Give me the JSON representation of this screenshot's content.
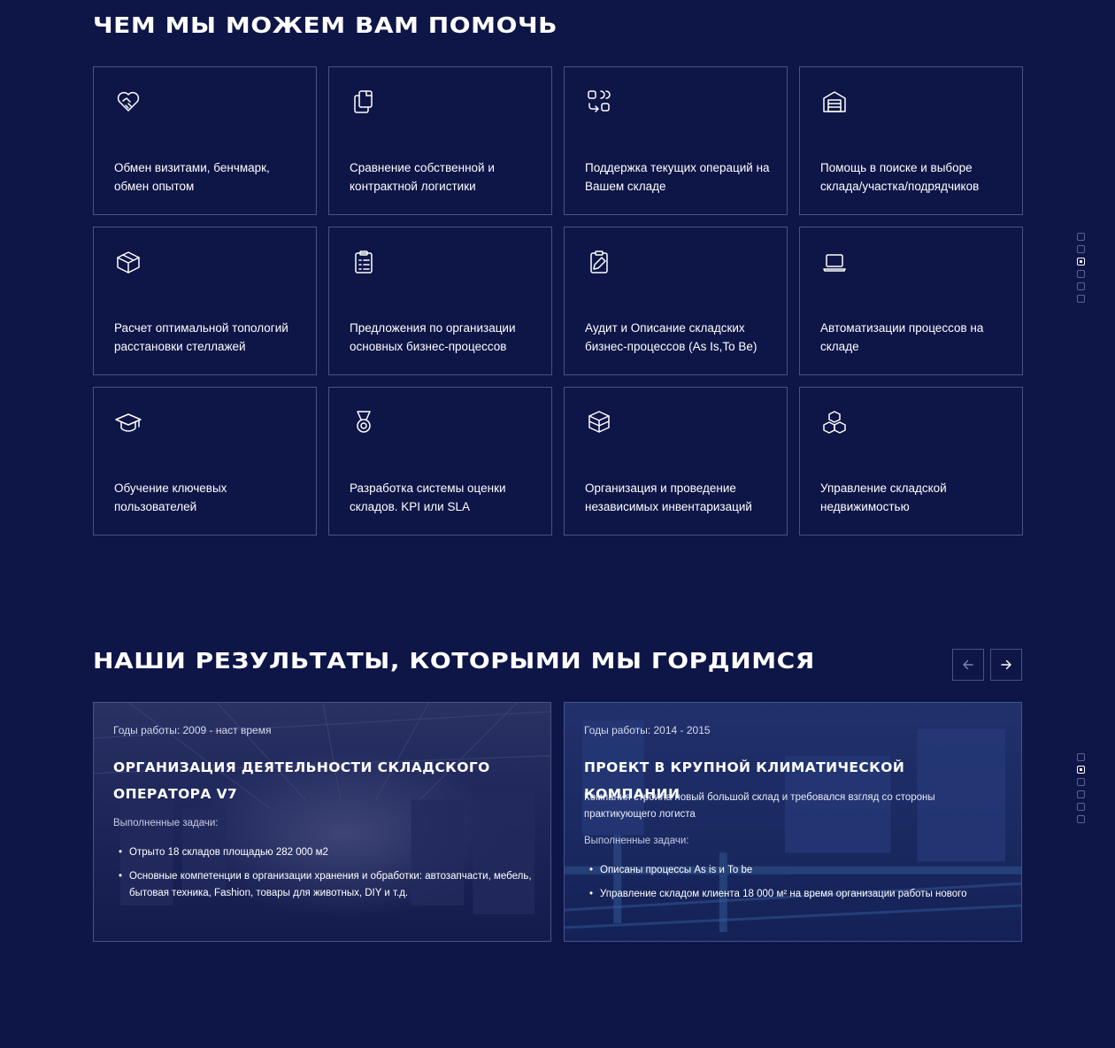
{
  "services": {
    "title": "ЧЕМ МЫ МОЖЕМ ВАМ ПОМОЧЬ",
    "cards": [
      {
        "icon": "handshake-heart-icon",
        "text": "Обмен визитами, бенчмарк, обмен опытом"
      },
      {
        "icon": "documents-copy-icon",
        "text": "Сравнение собственной и контрактной логистики"
      },
      {
        "icon": "workflow-shapes-icon",
        "text": "Поддержка текущих операций на Вашем складе"
      },
      {
        "icon": "warehouse-icon",
        "text": "Помощь в поиске и выборе склада/участка/подрядчиков"
      },
      {
        "icon": "box-3d-icon",
        "text": "Расчет оптимальной топологий расстановки стеллажей"
      },
      {
        "icon": "clipboard-list-icon",
        "text": "Предложения по организации основных бизнес-процессов"
      },
      {
        "icon": "clipboard-edit-icon",
        "text": "Аудит и Описание складских бизнес-процессов (As Is,To Be)"
      },
      {
        "icon": "laptop-icon",
        "text": "Автоматизации процессов на складе"
      },
      {
        "icon": "graduation-cap-icon",
        "text": "Обучение ключевых пользователей"
      },
      {
        "icon": "medal-icon",
        "text": "Разработка системы оценки складов. KPI или SLA"
      },
      {
        "icon": "boxes-stack-icon",
        "text": "Организация и проведение независимых инвентаризаций"
      },
      {
        "icon": "cubes-icon",
        "text": "Управление складской недвижимостью"
      }
    ],
    "pager": {
      "count": 6,
      "active": 2
    }
  },
  "results": {
    "title": "НАШИ РЕЗУЛЬТАТЫ, КОТОРЫМИ МЫ ГОРДИМСЯ",
    "prev_icon": "arrow-left-icon",
    "next_icon": "arrow-right-icon",
    "pager": {
      "count": 6,
      "active": 1
    },
    "projects": [
      {
        "years": "Годы работы: 2009 - наст время",
        "title": "ОРГАНИЗАЦИЯ ДЕЯТЕЛЬНОСТИ СКЛАДСКОГО ОПЕРАТОРА V7",
        "desc": "",
        "tasks_label": "Выполненные задачи:",
        "tasks": [
          "Отрыто 18 складов площадью 282 000 м2",
          "Основные компетенции в организации хранения и обработки: автозапчасти, мебель, бытовая техника, Fashion, товары для животных, DIY и т.д."
        ]
      },
      {
        "years": "Годы работы: 2014 - 2015",
        "title": "ПРОЕКТ В КРУПНОЙ КЛИМАТИЧЕСКОЙ КОМПАНИИ",
        "desc": "Компания строила новый большой склад и требовался взгляд со стороны практикующего логиста",
        "tasks_label": "Выполненные задачи:",
        "tasks": [
          "Описаны процессы As is и To be",
          "Управление складом клиента 18 000 м² на время организации работы нового"
        ]
      }
    ]
  }
}
